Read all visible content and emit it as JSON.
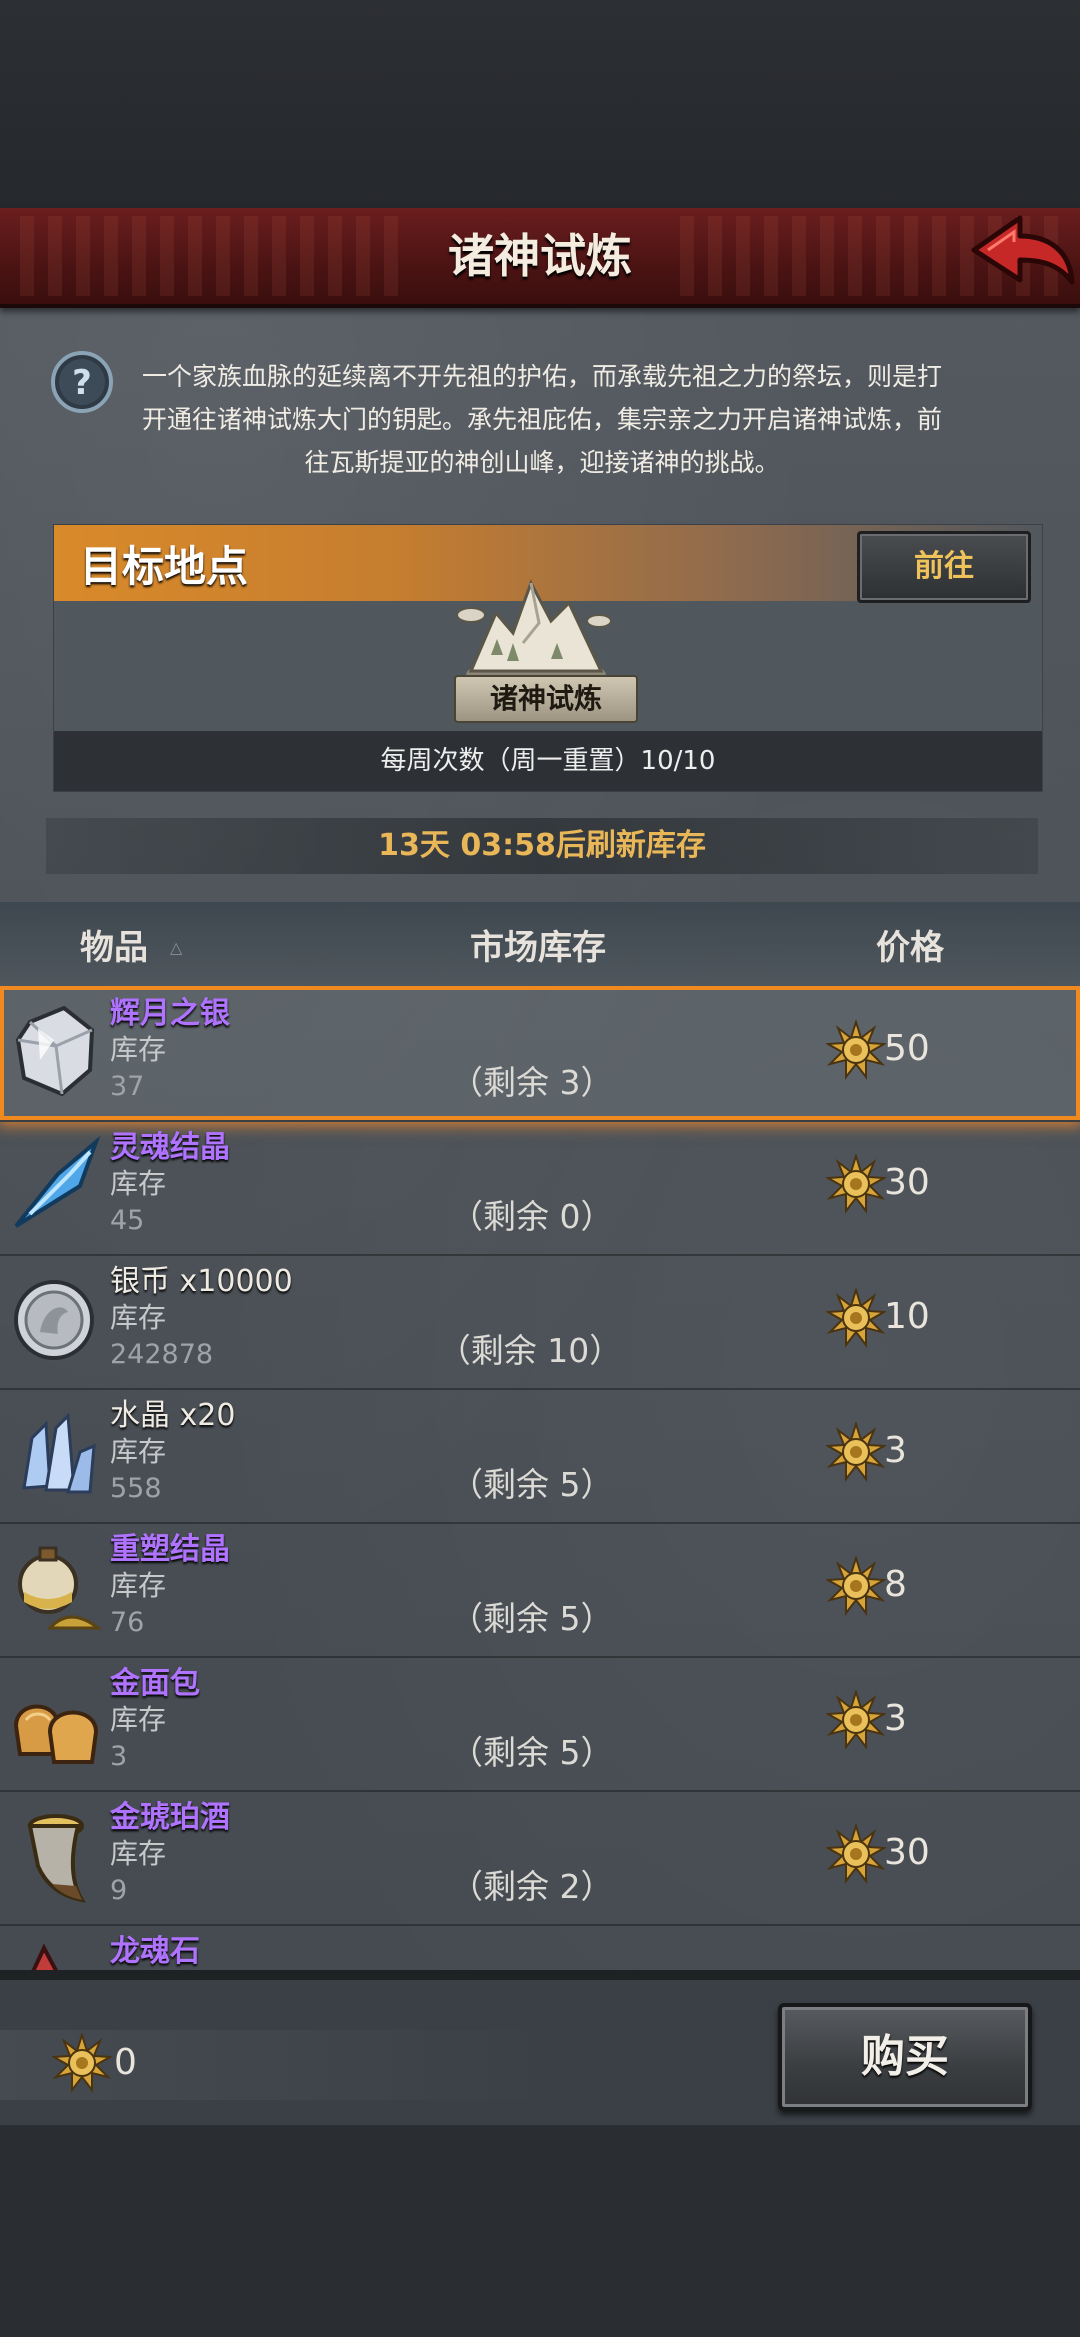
{
  "header": {
    "title": "诸神试炼"
  },
  "description": "一个家族血脉的延续离不开先祖的护佑，而承载先祖之力的祭坛，则是打开通往诸神试炼大门的钥匙。承先祖庇佑，集宗亲之力开启诸神试炼，前往瓦斯提亚的神创山峰，迎接诸神的挑战。",
  "target": {
    "title": "目标地点",
    "goto_label": "前往",
    "location_name": "诸神试炼",
    "weekly_attempts": "每周次数（周一重置）10/10"
  },
  "refresh_text": "13天 03:58后刷新库存",
  "table": {
    "col_item": "物品",
    "sort_indicator": "△",
    "col_stock": "市场库存",
    "col_price": "价格",
    "rows": [
      {
        "name": "辉月之银",
        "stock_label": "库存",
        "stock": "37",
        "remaining": "（剩余 3）",
        "price": "50"
      },
      {
        "name": "灵魂结晶",
        "stock_label": "库存",
        "stock": "45",
        "remaining": "（剩余 0）",
        "price": "30"
      },
      {
        "name": "银币 x10000",
        "stock_label": "库存",
        "stock": "242878",
        "remaining": "（剩余 10）",
        "price": "10"
      },
      {
        "name": "水晶 x20",
        "stock_label": "库存",
        "stock": "558",
        "remaining": "（剩余 5）",
        "price": "3"
      },
      {
        "name": "重塑结晶",
        "stock_label": "库存",
        "stock": "76",
        "remaining": "（剩余 5）",
        "price": "8"
      },
      {
        "name": "金面包",
        "stock_label": "库存",
        "stock": "3",
        "remaining": "（剩余 5）",
        "price": "3"
      },
      {
        "name": "金琥珀酒",
        "stock_label": "库存",
        "stock": "9",
        "remaining": "（剩余 2）",
        "price": "30"
      },
      {
        "name": "龙魂石"
      }
    ]
  },
  "wallet": {
    "balance": "0"
  },
  "buy_label": "购买",
  "colors": {
    "header": "#5a1818",
    "accent_orange": "#f08a1e",
    "rare_purple": "#b073ff",
    "refresh_gold": "#e9b758"
  }
}
